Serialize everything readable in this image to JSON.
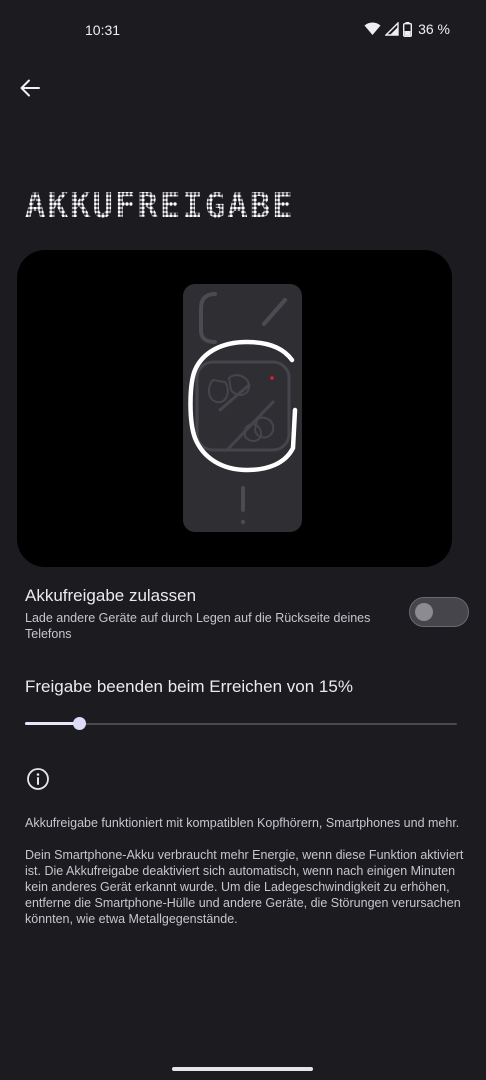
{
  "status_bar": {
    "time": "10:31",
    "battery_percent": "36 %",
    "icons": [
      "wifi-icon",
      "cellular-signal-icon",
      "battery-icon"
    ]
  },
  "header": {
    "back_icon": "arrow-left-icon",
    "title": "AKKUFREIGABE"
  },
  "illustration": {
    "description_icon": "phone-reverse-charging-illustration",
    "accent_color": "#e0212b"
  },
  "setting": {
    "title": "Akkufreigabe zulassen",
    "subtitle": "Lade andere Geräte auf durch Legen auf die Rückseite deines Telefons",
    "enabled": false
  },
  "slider": {
    "title": "Freigabe beenden beim Erreichen von 15%",
    "value_fraction": 0.125
  },
  "info": {
    "icon": "info-icon",
    "paragraph_1": "Akkufreigabe funktioniert mit kompatiblen Kopfhörern, Smartphones und mehr.",
    "paragraph_2": "Dein Smartphone-Akku verbraucht mehr Energie, wenn diese Funktion aktiviert ist. Die Akkufreigabe deaktiviert sich automatisch, wenn nach einigen Minuten kein anderes Gerät erkannt wurde. Um die Ladegeschwindigkeit zu erhöhen, entferne die Smartphone-Hülle und andere Geräte, die Störungen verursachen könnten, wie etwa Metallgegenstände."
  },
  "colors": {
    "background": "#1c1b20",
    "illustration_bg": "#000000",
    "slider_accent": "#dcdcf8"
  }
}
